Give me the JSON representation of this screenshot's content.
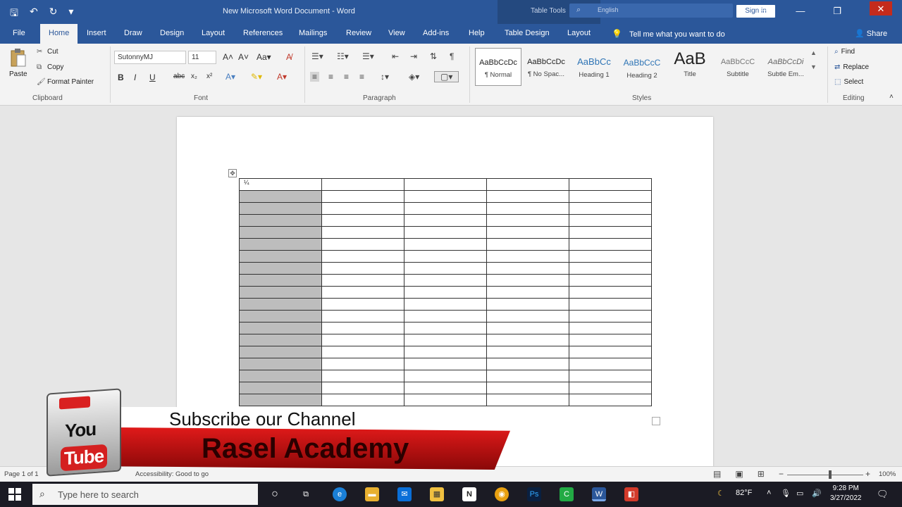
{
  "title_bar": {
    "document_title": "New Microsoft Word Document  -  Word",
    "table_tools": "Table Tools",
    "search_text": "English",
    "sign_in": "Sign in"
  },
  "tabs": [
    "File",
    "Home",
    "Insert",
    "Draw",
    "Design",
    "Layout",
    "References",
    "Mailings",
    "Review",
    "View",
    "Add-ins",
    "Help",
    "Table Design",
    "Layout"
  ],
  "tell_me": "Tell me what you want to do",
  "share": "Share",
  "clipboard": {
    "paste": "Paste",
    "cut": "Cut",
    "copy": "Copy",
    "format_painter": "Format Painter",
    "label": "Clipboard"
  },
  "font": {
    "name": "SutonnyMJ",
    "size": "11",
    "label": "Font"
  },
  "paragraph": {
    "label": "Paragraph"
  },
  "styles": {
    "label": "Styles",
    "items": [
      {
        "sample": "AaBbCcDc",
        "name": "¶ Normal"
      },
      {
        "sample": "AaBbCcDc",
        "name": "¶ No Spac..."
      },
      {
        "sample": "AaBbCc",
        "name": "Heading 1"
      },
      {
        "sample": "AaBbCcC",
        "name": "Heading 2"
      },
      {
        "sample": "AaB",
        "name": "Title"
      },
      {
        "sample": "AaBbCcC",
        "name": "Subtitle"
      },
      {
        "sample": "AaBbCcDi",
        "name": "Subtle Em..."
      }
    ]
  },
  "editing": {
    "find": "Find",
    "replace": "Replace",
    "select": "Select",
    "label": "Editing"
  },
  "table": {
    "first_cell": "¼",
    "rows": 19,
    "cols": 5
  },
  "status": {
    "page": "Page 1 of 1",
    "accessibility": "Accessibility: Good to go",
    "zoom": "100%"
  },
  "taskbar": {
    "search_placeholder": "Type here to search",
    "temperature": "82°F",
    "time": "9:28 PM",
    "date": "3/27/2022"
  },
  "overlay": {
    "subscribe": "Subscribe our Channel",
    "channel": "Rasel Academy",
    "you": "You",
    "tube": "Tube"
  },
  "colors": {
    "word_blue": "#2b579a",
    "banner_red": "#e01a1a"
  }
}
